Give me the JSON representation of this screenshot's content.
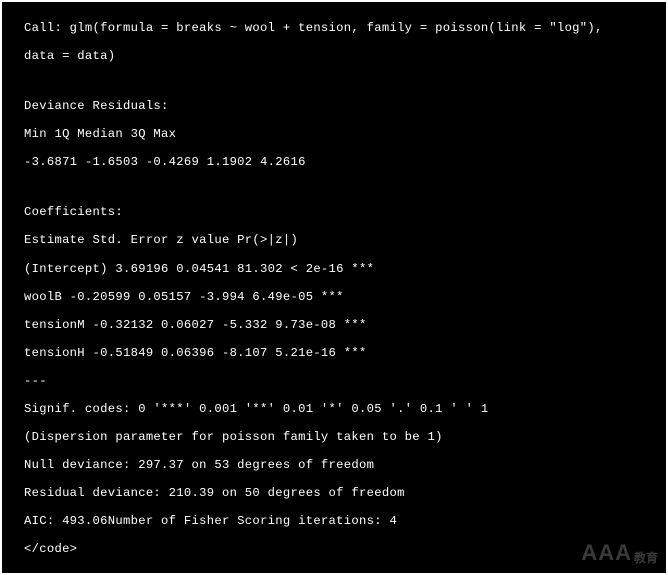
{
  "output": {
    "call_line1": "Call: glm(formula = breaks ~ wool + tension, family = poisson(link = \"log\"),",
    "call_line2": "data = data)",
    "dev_header": "Deviance Residuals:",
    "dev_labels": "Min 1Q Median 3Q Max",
    "dev_values": "-3.6871 -1.6503 -0.4269 1.1902 4.2616",
    "coef_header": "Coefficients:",
    "coef_cols": "Estimate Std. Error z value Pr(>|z|)",
    "coef_rows": {
      "intercept": "(Intercept) 3.69196 0.04541 81.302 < 2e-16 ***",
      "woolB": "woolB -0.20599 0.05157 -3.994 6.49e-05 ***",
      "tensionM": "tensionM -0.32132 0.06027 -5.332 9.73e-08 ***",
      "tensionH": "tensionH -0.51849 0.06396 -8.107 5.21e-16 ***"
    },
    "sep": "---",
    "signif": "Signif. codes: 0 '***' 0.001 '**' 0.01 '*' 0.05 '.' 0.1 ' ' 1",
    "dispersion": "(Dispersion parameter for poisson family taken to be 1)",
    "null_dev": "Null deviance: 297.37 on 53 degrees of freedom",
    "resid_dev": "Residual deviance: 210.39 on 50 degrees of freedom",
    "aic": "AIC: 493.06Number of Fisher Scoring iterations: 4",
    "end_tag": "</code>"
  },
  "watermark": {
    "main": "AAA",
    "sub": "教育"
  }
}
